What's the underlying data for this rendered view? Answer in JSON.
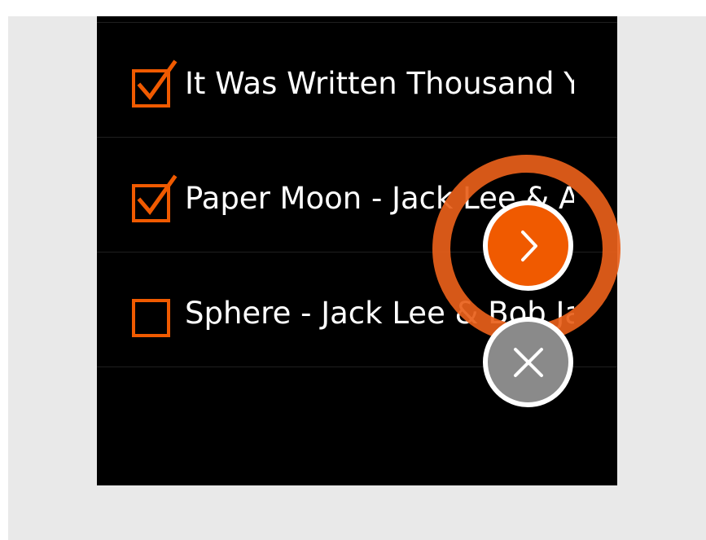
{
  "songs": [
    {
      "label": "It Was Written Thousand Years Ago - Jack Lee & Bob James",
      "checked": true
    },
    {
      "label": "Paper Moon - Jack Lee & Alan Broadbent",
      "checked": true
    },
    {
      "label": "Sphere - Jack Lee & Bob James",
      "checked": false
    }
  ],
  "actions": {
    "next": {
      "icon": "chevron-right-icon"
    },
    "cancel": {
      "icon": "close-icon"
    }
  },
  "colors": {
    "accent": "#f05a00",
    "ring": "#e85f1a",
    "background": "#000000",
    "cancel": "#8a8a8a",
    "text": "#ffffff"
  }
}
